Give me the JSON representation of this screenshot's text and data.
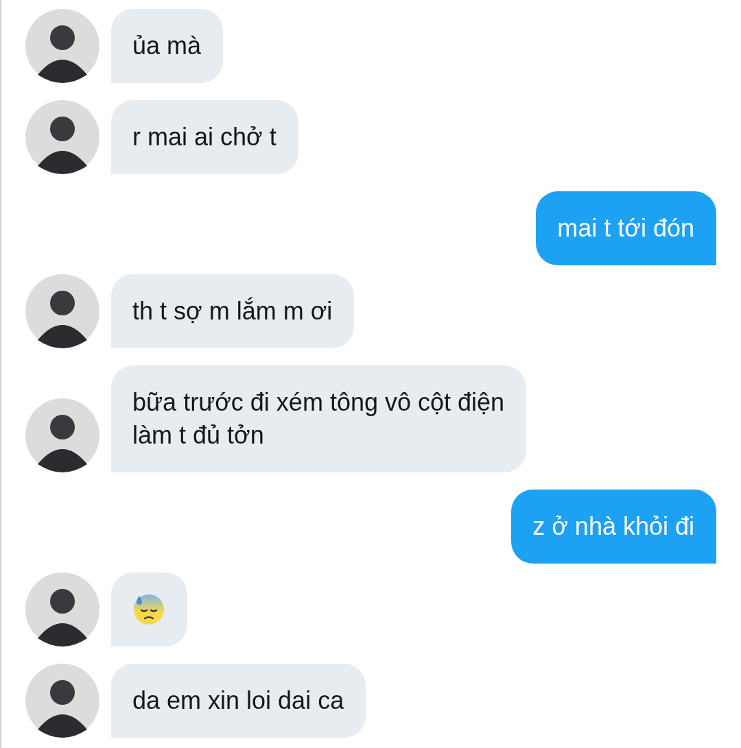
{
  "messages": [
    {
      "outgoing": false,
      "kind": "text",
      "text": "ủa mà"
    },
    {
      "outgoing": false,
      "kind": "text",
      "text": "r mai ai chở t"
    },
    {
      "outgoing": true,
      "kind": "text",
      "text": "mai t tới đón"
    },
    {
      "outgoing": false,
      "kind": "text",
      "text": "th t sợ m lắm m ơi"
    },
    {
      "outgoing": false,
      "kind": "text",
      "text": "bữa trước đi xém tông vô cột điện\nlàm t đủ tởn"
    },
    {
      "outgoing": true,
      "kind": "text",
      "text": "z ở nhà khỏi đi"
    },
    {
      "outgoing": false,
      "kind": "emoji"
    },
    {
      "outgoing": false,
      "kind": "text",
      "text": "da em xin loi dai ca"
    }
  ]
}
